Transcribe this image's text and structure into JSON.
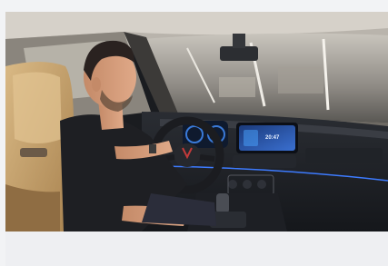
{
  "photo": {
    "subject": "man-driving-car-interior",
    "display_time": "20:47"
  }
}
